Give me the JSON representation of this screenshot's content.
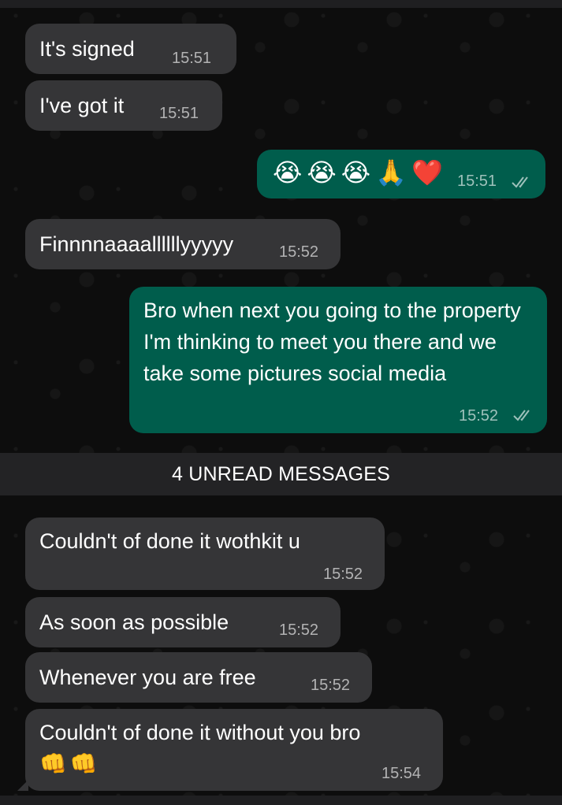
{
  "messages": [
    {
      "text": "It's signed",
      "time": "15:51"
    },
    {
      "text": "I've got it",
      "time": "15:51"
    },
    {
      "emojis": [
        "😭",
        "😭",
        "😭",
        "🙏",
        "❤️"
      ],
      "time": "15:51"
    },
    {
      "text": "Finnnnaaaallllllyyyyy",
      "time": "15:52"
    },
    {
      "text": "Bro when next you going to the property I'm thinking to meet you there and we take some pictures social media",
      "time": "15:52"
    },
    {
      "text": "Couldn't of done it wothkit u",
      "time": "15:52"
    },
    {
      "text": "As soon as possible",
      "time": "15:52"
    },
    {
      "text": "Whenever you are free",
      "time": "15:52"
    },
    {
      "text": "Couldn't of done it without you bro",
      "emojis": [
        "👊",
        "👊"
      ],
      "time": "15:54"
    }
  ],
  "unread_divider": "4 UNREAD MESSAGES",
  "colors": {
    "incoming_bubble": "#353537",
    "outgoing_bubble": "#005d4c",
    "background": "#0d0d0d"
  }
}
